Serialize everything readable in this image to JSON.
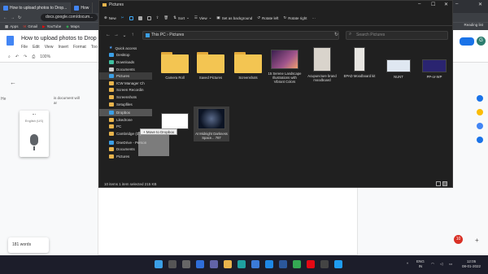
{
  "browser": {
    "tabs": [
      {
        "title": "How to upload photos to Drop...",
        "icon_color": "#4285f4",
        "active": false
      },
      {
        "title": "docs.google.com",
        "icon_color": "#4285f4",
        "active": true
      },
      {
        "title": "How",
        "icon_color": "#4285f4",
        "active": false
      }
    ],
    "url": "docs.google.com/docum...",
    "bookmarks": [
      "Apps",
      "Gmail",
      "YouTube",
      "Maps"
    ],
    "reading_list": "Reading list"
  },
  "docs": {
    "title": "How to upload photos to Drop",
    "menu": [
      "File",
      "Edit",
      "View",
      "Insert",
      "Format",
      "Too"
    ],
    "zoom": "100%",
    "heading_snip": "He",
    "body_snip": [
      "is document will",
      "ar"
    ],
    "voice": {
      "language": "English (US)"
    },
    "word_count": "181 words",
    "avatar_letter": "G",
    "notif_count": "10"
  },
  "explorer": {
    "title": "Pictures",
    "commands": [
      "New",
      "Sort",
      "View",
      "Set as background",
      "Rotate left",
      "Rotate right"
    ],
    "address": [
      "This PC",
      "Pictures"
    ],
    "search_placeholder": "Search Pictures",
    "sidebar": [
      {
        "label": "Quick access",
        "type": "star"
      },
      {
        "label": "Desktop",
        "type": "folder"
      },
      {
        "label": "Downloads",
        "type": "folder"
      },
      {
        "label": "Documents",
        "type": "folder"
      },
      {
        "label": "Pictures",
        "type": "folder",
        "selected": true
      },
      {
        "label": "ICW Manager Ch",
        "type": "folder"
      },
      {
        "label": "Screen Recordin",
        "type": "folder"
      },
      {
        "label": "Screenshots",
        "type": "folder"
      },
      {
        "label": "Setupfiles",
        "type": "folder"
      },
      {
        "label": "Dropbox",
        "type": "folder",
        "highlight": true
      },
      {
        "label": "Likedrone",
        "type": "folder"
      },
      {
        "label": "PC",
        "type": "folder"
      },
      {
        "label": "Cambridge (D:)",
        "type": "folder"
      },
      {
        "label": "OneDrive - Person",
        "type": "folder"
      },
      {
        "label": "Documents",
        "type": "folder"
      },
      {
        "label": "Pictures",
        "type": "folder"
      }
    ],
    "items": [
      {
        "label": "Camera Roll",
        "kind": "folder"
      },
      {
        "label": "Saved Pictures",
        "kind": "folder"
      },
      {
        "label": "Screenshots",
        "kind": "folder"
      },
      {
        "label": "15 Serene Landscape Illustrations with Vibrant Colors",
        "kind": "image",
        "color": "#6a3a6e"
      },
      {
        "label": "Acupuncture brand moodboard",
        "kind": "image",
        "color": "#d9d4cc"
      },
      {
        "label": "EPAD Moodboard kit",
        "kind": "image",
        "color": "#e8e6e2"
      },
      {
        "label": "NUNT",
        "kind": "image",
        "color": "#dfe7f1"
      },
      {
        "label": "PP-or-WP",
        "kind": "image",
        "color": "#2a2470"
      },
      {
        "label": "",
        "kind": "image",
        "color": "#ffffff"
      },
      {
        "label": "At Midnight Darkness Space... 787",
        "kind": "image",
        "color": "#101a2c"
      }
    ],
    "status": "10 items   1 item selected  215 KB",
    "drag_tip": "+ Move to Dropbox"
  },
  "taskbar": {
    "tray": [
      "ENG",
      "IN"
    ],
    "time": "12:05",
    "date": "08-01-2022"
  }
}
